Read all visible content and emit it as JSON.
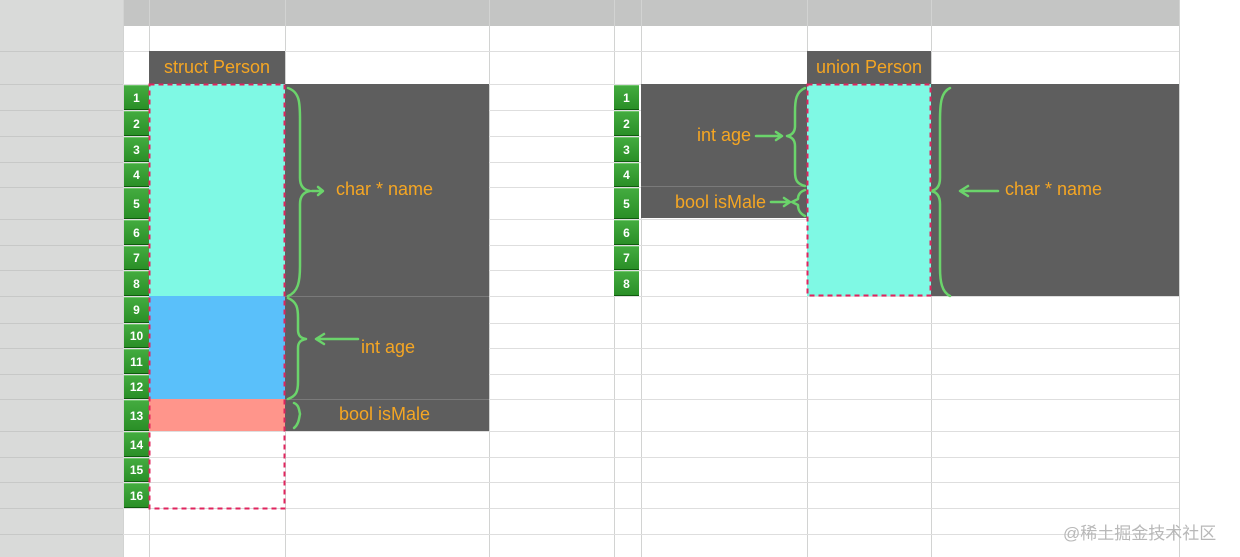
{
  "struct_diagram": {
    "title": "struct Person",
    "row_numbers": [
      "1",
      "2",
      "3",
      "4",
      "5",
      "6",
      "7",
      "8",
      "9",
      "10",
      "11",
      "12",
      "13",
      "14",
      "15",
      "16"
    ],
    "fields": [
      {
        "label": "char * name",
        "bytes": 8,
        "color": "#7ff9e4"
      },
      {
        "label": "int age",
        "bytes": 4,
        "color": "#5ac0fa"
      },
      {
        "label": "bool isMale",
        "bytes": 1,
        "color": "#ff958b"
      }
    ]
  },
  "union_diagram": {
    "title": "union Person",
    "row_numbers": [
      "1",
      "2",
      "3",
      "4",
      "5",
      "6",
      "7",
      "8"
    ],
    "fields": [
      {
        "label": "char * name",
        "bytes": 8,
        "color": "#7ff9e4"
      },
      {
        "label": "int age",
        "bytes": 4
      },
      {
        "label": "bool isMale",
        "bytes": 1
      }
    ]
  },
  "colors": {
    "label_orange": "#f5a623",
    "brace_green": "#6bd46b",
    "dashed_border": "#e0245e",
    "header_dark": "#5e5e5e",
    "row_green": "#2a8f27"
  },
  "watermark": "@稀土掘金技术社区"
}
